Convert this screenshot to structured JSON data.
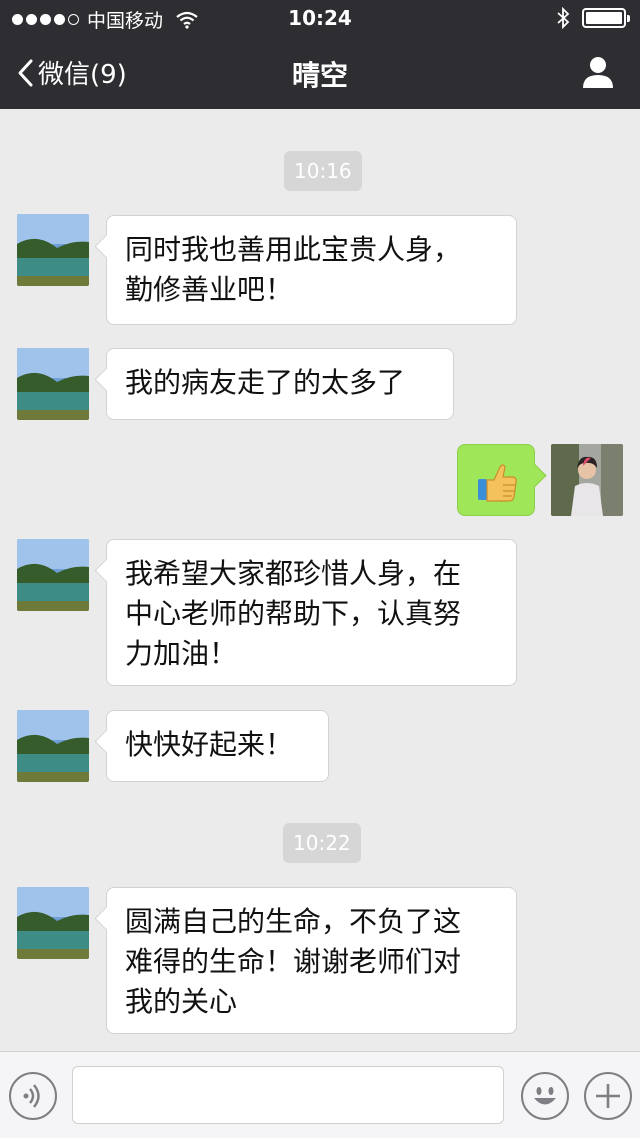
{
  "status_bar": {
    "carrier": "中国移动",
    "time": "10:24"
  },
  "nav": {
    "back_label": "微信(9)",
    "title": "晴空"
  },
  "chat": {
    "timestamps": [
      "10:16",
      "10:22"
    ],
    "messages": [
      {
        "side": "left",
        "lines": [
          "同时我也善用此宝贵人身，",
          "勤修善业吧！"
        ]
      },
      {
        "side": "left",
        "lines": [
          "我的病友走了的太多了"
        ]
      },
      {
        "side": "right",
        "content": "thumbs-up-emoji"
      },
      {
        "side": "left",
        "lines": [
          "我希望大家都珍惜人身，在",
          "中心老师的帮助下，认真努",
          "力加油！"
        ]
      },
      {
        "side": "left",
        "lines": [
          "快快好起来！"
        ]
      },
      {
        "side": "left",
        "lines": [
          "圆满自己的生命，不负了这",
          "难得的生命！谢谢老师们对",
          "我的关心"
        ]
      }
    ]
  },
  "input_bar": {
    "voice_icon": "voice-icon",
    "emoji_icon": "emoji-icon",
    "add_icon": "plus-icon"
  },
  "colors": {
    "header_bg": "#2e2e32",
    "chat_bg": "#ebebeb",
    "sent_bubble": "#9fe658"
  }
}
